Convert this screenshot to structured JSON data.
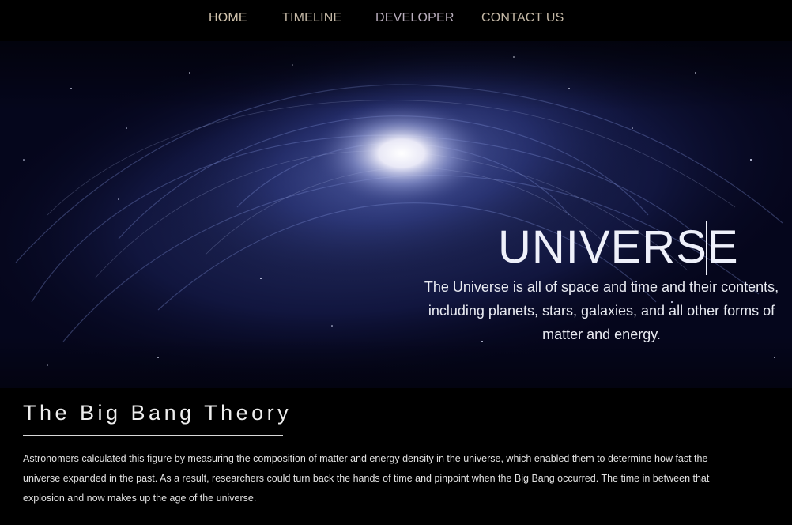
{
  "nav": {
    "items": [
      {
        "label": "HOME"
      },
      {
        "label": "TIMELINE"
      },
      {
        "label": "DEVELOPER"
      },
      {
        "label": "CONTACT US"
      }
    ]
  },
  "hero": {
    "title": "UNIVERSE",
    "description": "The Universe is all of space and time and their contents, including planets, stars, galaxies, and all other forms of matter and energy."
  },
  "section": {
    "title": "The Big Bang Theory",
    "body": "Astronomers calculated this figure by measuring the composition of matter and energy density in the universe, which enabled them to determine how fast the universe expanded in the past. As a result, researchers could turn back the hands of time and pinpoint when the Big Bang occurred. The time in between that explosion and now makes up the age of the universe."
  },
  "colors": {
    "background": "#000000",
    "nav_text": "#c4b8a6",
    "hero_text": "#eef0fa",
    "galaxy_blue": "#5a6fb8"
  }
}
